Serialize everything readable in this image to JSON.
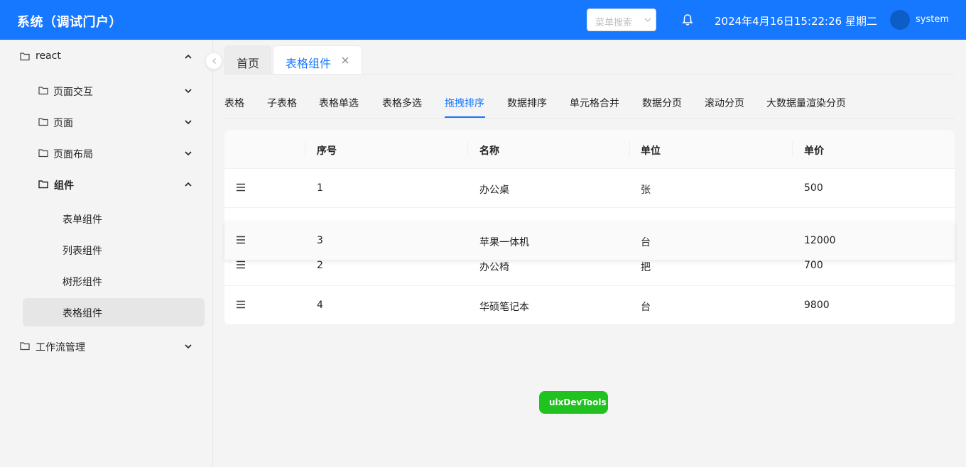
{
  "header": {
    "title": "系统（调试门户）",
    "search_placeholder": "菜单搜索",
    "datetime": "2024年4月16日15:22:26 星期二",
    "username": "system",
    "colors": {
      "primary": "#1677ff"
    }
  },
  "sidebar": {
    "items": [
      {
        "label": "react",
        "icon": "folder-icon",
        "arrow": "chevron-up-icon"
      },
      {
        "label": "页面交互",
        "icon": "folder-icon",
        "arrow": "chevron-down-icon"
      },
      {
        "label": "页面",
        "icon": "folder-icon",
        "arrow": "chevron-down-icon"
      },
      {
        "label": "页面布局",
        "icon": "folder-icon",
        "arrow": "chevron-down-icon"
      },
      {
        "label": "组件",
        "icon": "folder-icon",
        "arrow": "chevron-up-icon"
      },
      {
        "label": "表单组件"
      },
      {
        "label": "列表组件"
      },
      {
        "label": "树形组件"
      },
      {
        "label": "表格组件",
        "active": true
      },
      {
        "label": "工作流管理",
        "icon": "folder-icon",
        "arrow": "chevron-down-icon"
      }
    ]
  },
  "page_tabs": [
    {
      "label": "首页"
    },
    {
      "label": "表格组件",
      "active": true
    }
  ],
  "sub_tabs": [
    {
      "label": "表格"
    },
    {
      "label": "子表格"
    },
    {
      "label": "表格单选"
    },
    {
      "label": "表格多选"
    },
    {
      "label": "拖拽排序",
      "active": true
    },
    {
      "label": "数据排序"
    },
    {
      "label": "单元格合并"
    },
    {
      "label": "数据分页"
    },
    {
      "label": "滚动分页"
    },
    {
      "label": "大数据量渲染分页"
    }
  ],
  "table": {
    "columns": [
      "序号",
      "名称",
      "单位",
      "单价"
    ],
    "rows": [
      {
        "no": "1",
        "name": "办公桌",
        "unit": "张",
        "price": "500"
      },
      {
        "no": "2",
        "name": "办公椅",
        "unit": "把",
        "price": "700"
      },
      {
        "no": "4",
        "name": "华硕笔记本",
        "unit": "台",
        "price": "9800"
      }
    ],
    "dragging_row": {
      "no": "3",
      "name": "苹果一体机",
      "unit": "台",
      "price": "12000"
    }
  },
  "devtools_label": "uixDevTools"
}
